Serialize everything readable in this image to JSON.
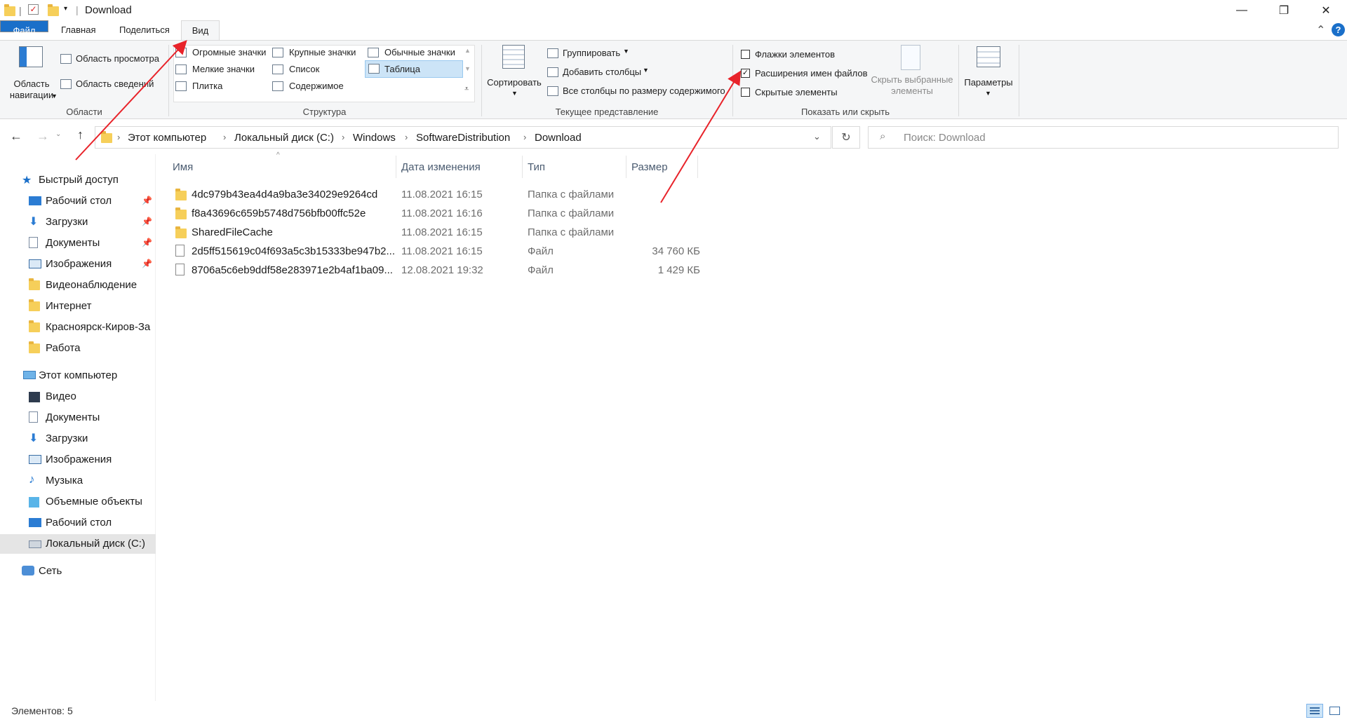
{
  "window": {
    "title": "Download",
    "minimize_glyph": "—",
    "maximize_glyph": "❐",
    "close_glyph": "✕",
    "collapse_glyph": "⌃",
    "help_glyph": "?"
  },
  "tabs": [
    {
      "label": "Файл"
    },
    {
      "label": "Главная"
    },
    {
      "label": "Поделиться"
    },
    {
      "label": "Вид"
    }
  ],
  "ribbon": {
    "panes": {
      "nav_pane_label": "Область\nнавигации",
      "preview_pane": "Область просмотра",
      "details_pane": "Область сведений",
      "group": "Области"
    },
    "layout": {
      "items": [
        "Огромные значки",
        "Крупные значки",
        "Обычные значки",
        "Мелкие значки",
        "Список",
        "Таблица",
        "Плитка",
        "Содержимое"
      ],
      "selected": "Таблица",
      "group": "Структура"
    },
    "current_view": {
      "sort": "Сортировать",
      "group_by": "Группировать",
      "add_columns": "Добавить столбцы",
      "size_all": "Все столбцы по размеру содержимого",
      "group": "Текущее представление"
    },
    "show_hide": {
      "item_checkboxes": {
        "label": "Флажки элементов",
        "checked": false
      },
      "file_extensions": {
        "label": "Расширения имен файлов",
        "checked": true
      },
      "hidden_items": {
        "label": "Скрытые элементы",
        "checked": false
      },
      "hide_selected": "Скрыть выбранные\nэлементы",
      "group": "Показать или скрыть"
    },
    "options": "Параметры"
  },
  "address": {
    "crumbs": [
      "Этот компьютер",
      "Локальный диск (C:)",
      "Windows",
      "SoftwareDistribution",
      "Download"
    ],
    "search_placeholder": "Поиск: Download"
  },
  "nav": {
    "quick_access": "Быстрый доступ",
    "quick_items": [
      {
        "label": "Рабочий стол",
        "pinned": true,
        "icon": "desktop-icon"
      },
      {
        "label": "Загрузки",
        "pinned": true,
        "icon": "downloads-icon"
      },
      {
        "label": "Документы",
        "pinned": true,
        "icon": "documents-icon"
      },
      {
        "label": "Изображения",
        "pinned": true,
        "icon": "pictures-icon"
      },
      {
        "label": "Видеонаблюдение",
        "pinned": false,
        "icon": "folder-icon"
      },
      {
        "label": "Интернет",
        "pinned": false,
        "icon": "folder-icon"
      },
      {
        "label": "Красноярск-Киров-За",
        "pinned": false,
        "icon": "folder-icon"
      },
      {
        "label": "Работа",
        "pinned": false,
        "icon": "folder-icon"
      }
    ],
    "this_pc": "Этот компьютер",
    "pc_items": [
      {
        "label": "Видео",
        "icon": "video-icon"
      },
      {
        "label": "Документы",
        "icon": "documents-icon"
      },
      {
        "label": "Загрузки",
        "icon": "downloads-icon"
      },
      {
        "label": "Изображения",
        "icon": "pictures-icon"
      },
      {
        "label": "Музыка",
        "icon": "music-icon"
      },
      {
        "label": "Объемные объекты",
        "icon": "3d-objects-icon"
      },
      {
        "label": "Рабочий стол",
        "icon": "desktop-icon"
      },
      {
        "label": "Локальный диск (C:)",
        "icon": "drive-icon",
        "selected": true
      }
    ],
    "network": "Сеть"
  },
  "list": {
    "columns": [
      "Имя",
      "Дата изменения",
      "Тип",
      "Размер"
    ],
    "rows": [
      {
        "name": "4dc979b43ea4d4a9ba3e34029e9264cd",
        "date": "11.08.2021 16:15",
        "type": "Папка с файлами",
        "size": "",
        "kind": "folder"
      },
      {
        "name": "f8a43696c659b5748d756bfb00ffc52e",
        "date": "11.08.2021 16:16",
        "type": "Папка с файлами",
        "size": "",
        "kind": "folder"
      },
      {
        "name": "SharedFileCache",
        "date": "11.08.2021 16:15",
        "type": "Папка с файлами",
        "size": "",
        "kind": "folder"
      },
      {
        "name": "2d5ff515619c04f693a5c3b15333be947b2...",
        "date": "11.08.2021 16:15",
        "type": "Файл",
        "size": "34 760 КБ",
        "kind": "file"
      },
      {
        "name": "8706a5c6eb9ddf58e283971e2b4af1ba09...",
        "date": "12.08.2021 19:32",
        "type": "Файл",
        "size": "1 429 КБ",
        "kind": "file"
      }
    ]
  },
  "status": "Элементов: 5",
  "colors": {
    "accent": "#1a6fc9",
    "annotation": "#e8232a",
    "folder": "#f6cf5a"
  }
}
